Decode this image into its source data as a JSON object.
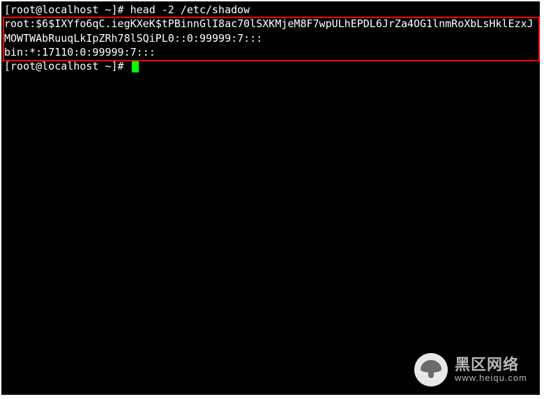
{
  "terminal": {
    "prompt1": "[root@localhost ~]# ",
    "command1": "head -2 /etc/shadow",
    "output_line1": "root:$6$IXYfo6qC.iegKXeK$tPBinnGlI8ac70lSXKMjeM8F7wpULhEPDL6JrZa4OG1lnmRoXbLsHklEzxJMOWTWAbRuuqLkIpZRh78lSQiPL0::0:99999:7:::",
    "output_line2": "bin:*:17110:0:99999:7:::",
    "prompt2": "[root@localhost ~]# "
  },
  "watermark": {
    "main": "黑区网络",
    "sub": "www.heiqu.com"
  }
}
